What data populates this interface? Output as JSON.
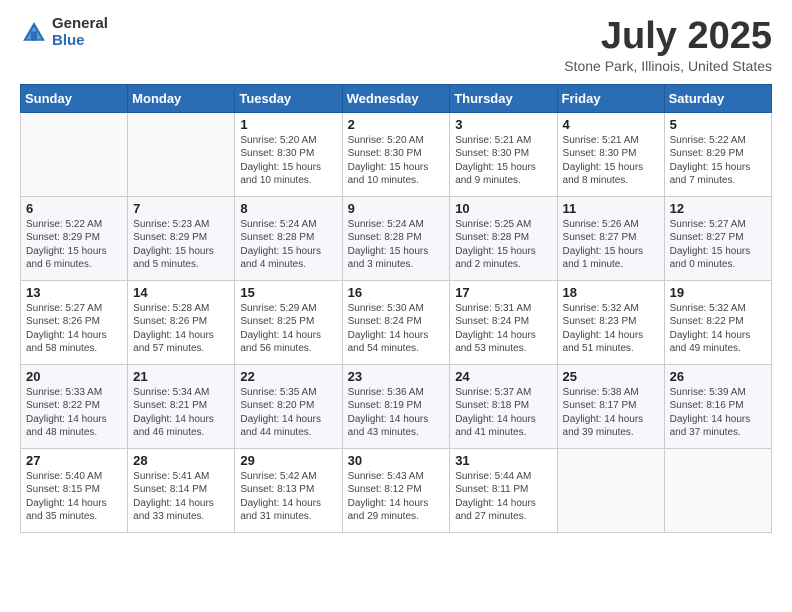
{
  "header": {
    "logo_general": "General",
    "logo_blue": "Blue",
    "month_title": "July 2025",
    "location": "Stone Park, Illinois, United States"
  },
  "weekdays": [
    "Sunday",
    "Monday",
    "Tuesday",
    "Wednesday",
    "Thursday",
    "Friday",
    "Saturday"
  ],
  "weeks": [
    [
      {
        "day": "",
        "info": ""
      },
      {
        "day": "",
        "info": ""
      },
      {
        "day": "1",
        "info": "Sunrise: 5:20 AM\nSunset: 8:30 PM\nDaylight: 15 hours\nand 10 minutes."
      },
      {
        "day": "2",
        "info": "Sunrise: 5:20 AM\nSunset: 8:30 PM\nDaylight: 15 hours\nand 10 minutes."
      },
      {
        "day": "3",
        "info": "Sunrise: 5:21 AM\nSunset: 8:30 PM\nDaylight: 15 hours\nand 9 minutes."
      },
      {
        "day": "4",
        "info": "Sunrise: 5:21 AM\nSunset: 8:30 PM\nDaylight: 15 hours\nand 8 minutes."
      },
      {
        "day": "5",
        "info": "Sunrise: 5:22 AM\nSunset: 8:29 PM\nDaylight: 15 hours\nand 7 minutes."
      }
    ],
    [
      {
        "day": "6",
        "info": "Sunrise: 5:22 AM\nSunset: 8:29 PM\nDaylight: 15 hours\nand 6 minutes."
      },
      {
        "day": "7",
        "info": "Sunrise: 5:23 AM\nSunset: 8:29 PM\nDaylight: 15 hours\nand 5 minutes."
      },
      {
        "day": "8",
        "info": "Sunrise: 5:24 AM\nSunset: 8:28 PM\nDaylight: 15 hours\nand 4 minutes."
      },
      {
        "day": "9",
        "info": "Sunrise: 5:24 AM\nSunset: 8:28 PM\nDaylight: 15 hours\nand 3 minutes."
      },
      {
        "day": "10",
        "info": "Sunrise: 5:25 AM\nSunset: 8:28 PM\nDaylight: 15 hours\nand 2 minutes."
      },
      {
        "day": "11",
        "info": "Sunrise: 5:26 AM\nSunset: 8:27 PM\nDaylight: 15 hours\nand 1 minute."
      },
      {
        "day": "12",
        "info": "Sunrise: 5:27 AM\nSunset: 8:27 PM\nDaylight: 15 hours\nand 0 minutes."
      }
    ],
    [
      {
        "day": "13",
        "info": "Sunrise: 5:27 AM\nSunset: 8:26 PM\nDaylight: 14 hours\nand 58 minutes."
      },
      {
        "day": "14",
        "info": "Sunrise: 5:28 AM\nSunset: 8:26 PM\nDaylight: 14 hours\nand 57 minutes."
      },
      {
        "day": "15",
        "info": "Sunrise: 5:29 AM\nSunset: 8:25 PM\nDaylight: 14 hours\nand 56 minutes."
      },
      {
        "day": "16",
        "info": "Sunrise: 5:30 AM\nSunset: 8:24 PM\nDaylight: 14 hours\nand 54 minutes."
      },
      {
        "day": "17",
        "info": "Sunrise: 5:31 AM\nSunset: 8:24 PM\nDaylight: 14 hours\nand 53 minutes."
      },
      {
        "day": "18",
        "info": "Sunrise: 5:32 AM\nSunset: 8:23 PM\nDaylight: 14 hours\nand 51 minutes."
      },
      {
        "day": "19",
        "info": "Sunrise: 5:32 AM\nSunset: 8:22 PM\nDaylight: 14 hours\nand 49 minutes."
      }
    ],
    [
      {
        "day": "20",
        "info": "Sunrise: 5:33 AM\nSunset: 8:22 PM\nDaylight: 14 hours\nand 48 minutes."
      },
      {
        "day": "21",
        "info": "Sunrise: 5:34 AM\nSunset: 8:21 PM\nDaylight: 14 hours\nand 46 minutes."
      },
      {
        "day": "22",
        "info": "Sunrise: 5:35 AM\nSunset: 8:20 PM\nDaylight: 14 hours\nand 44 minutes."
      },
      {
        "day": "23",
        "info": "Sunrise: 5:36 AM\nSunset: 8:19 PM\nDaylight: 14 hours\nand 43 minutes."
      },
      {
        "day": "24",
        "info": "Sunrise: 5:37 AM\nSunset: 8:18 PM\nDaylight: 14 hours\nand 41 minutes."
      },
      {
        "day": "25",
        "info": "Sunrise: 5:38 AM\nSunset: 8:17 PM\nDaylight: 14 hours\nand 39 minutes."
      },
      {
        "day": "26",
        "info": "Sunrise: 5:39 AM\nSunset: 8:16 PM\nDaylight: 14 hours\nand 37 minutes."
      }
    ],
    [
      {
        "day": "27",
        "info": "Sunrise: 5:40 AM\nSunset: 8:15 PM\nDaylight: 14 hours\nand 35 minutes."
      },
      {
        "day": "28",
        "info": "Sunrise: 5:41 AM\nSunset: 8:14 PM\nDaylight: 14 hours\nand 33 minutes."
      },
      {
        "day": "29",
        "info": "Sunrise: 5:42 AM\nSunset: 8:13 PM\nDaylight: 14 hours\nand 31 minutes."
      },
      {
        "day": "30",
        "info": "Sunrise: 5:43 AM\nSunset: 8:12 PM\nDaylight: 14 hours\nand 29 minutes."
      },
      {
        "day": "31",
        "info": "Sunrise: 5:44 AM\nSunset: 8:11 PM\nDaylight: 14 hours\nand 27 minutes."
      },
      {
        "day": "",
        "info": ""
      },
      {
        "day": "",
        "info": ""
      }
    ]
  ]
}
